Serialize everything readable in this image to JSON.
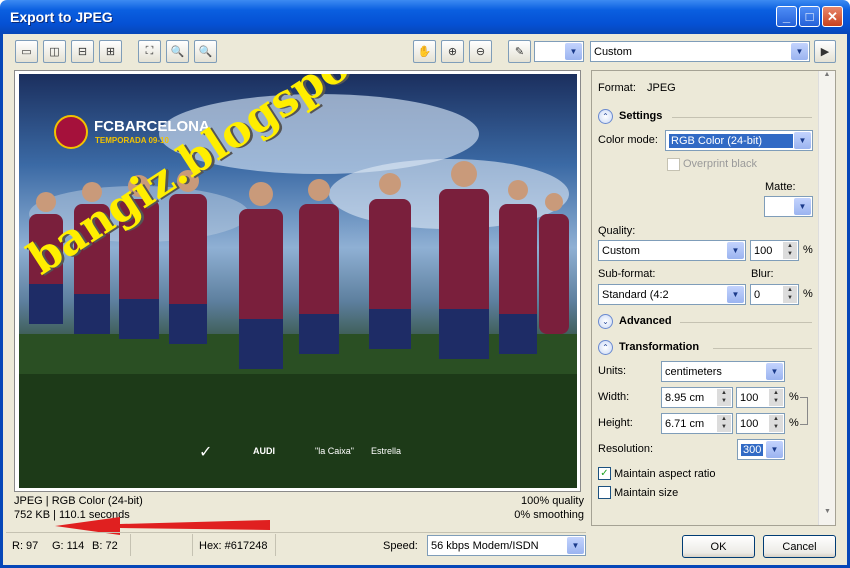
{
  "window": {
    "title": "Export to JPEG"
  },
  "toolbar": {
    "preset_value": "Custom",
    "colorpicker_value": ""
  },
  "preview_image": {
    "logo_text": "FCBARCELONA",
    "logo_sub": "TEMPORADA 09-10",
    "watermark": "bangiz.blogspot.com",
    "sponsor_labels": [
      "AUDI",
      "\"la Caixa\"",
      "Estrella"
    ]
  },
  "status": {
    "format_line": "JPEG  |  RGB Color (24-bit)",
    "size_line": "752 KB  |  110.1 seconds",
    "quality_line": "100% quality",
    "smoothing_line": "0% smoothing",
    "rgb_r": "R: 97",
    "rgb_g": "G: 114",
    "rgb_b": "B: 72",
    "hex": "Hex: #617248",
    "speed_label": "Speed:",
    "speed_value": "56 kbps Modem/ISDN"
  },
  "panel": {
    "format_label": "Format:",
    "format_value": "JPEG",
    "settings_title": "Settings",
    "color_mode_label": "Color mode:",
    "color_mode_value": "RGB Color (24-bit)",
    "overprint_label": "Overprint black",
    "matte_label": "Matte:",
    "quality_label": "Quality:",
    "quality_value": "Custom",
    "quality_pct": "100",
    "pct": "%",
    "subformat_label": "Sub-format:",
    "subformat_value": "Standard (4:2",
    "blur_label": "Blur:",
    "blur_value": "0",
    "advanced_title": "Advanced",
    "transformation_title": "Transformation",
    "units_label": "Units:",
    "units_value": "centimeters",
    "width_label": "Width:",
    "width_value": "8.95 cm",
    "width_pct": "100",
    "height_label": "Height:",
    "height_value": "6.71 cm",
    "height_pct": "100",
    "resolution_label": "Resolution:",
    "resolution_value": "300",
    "maintain_aspect_label": "Maintain aspect ratio",
    "maintain_aspect_checked": true,
    "maintain_size_label": "Maintain size",
    "maintain_size_checked": false
  },
  "buttons": {
    "ok": "OK",
    "cancel": "Cancel"
  },
  "colors": {
    "titlebar": "#0551d4",
    "accent_arrow": "#e02020",
    "watermark": "#ffee00",
    "selection": "#316ac5"
  }
}
